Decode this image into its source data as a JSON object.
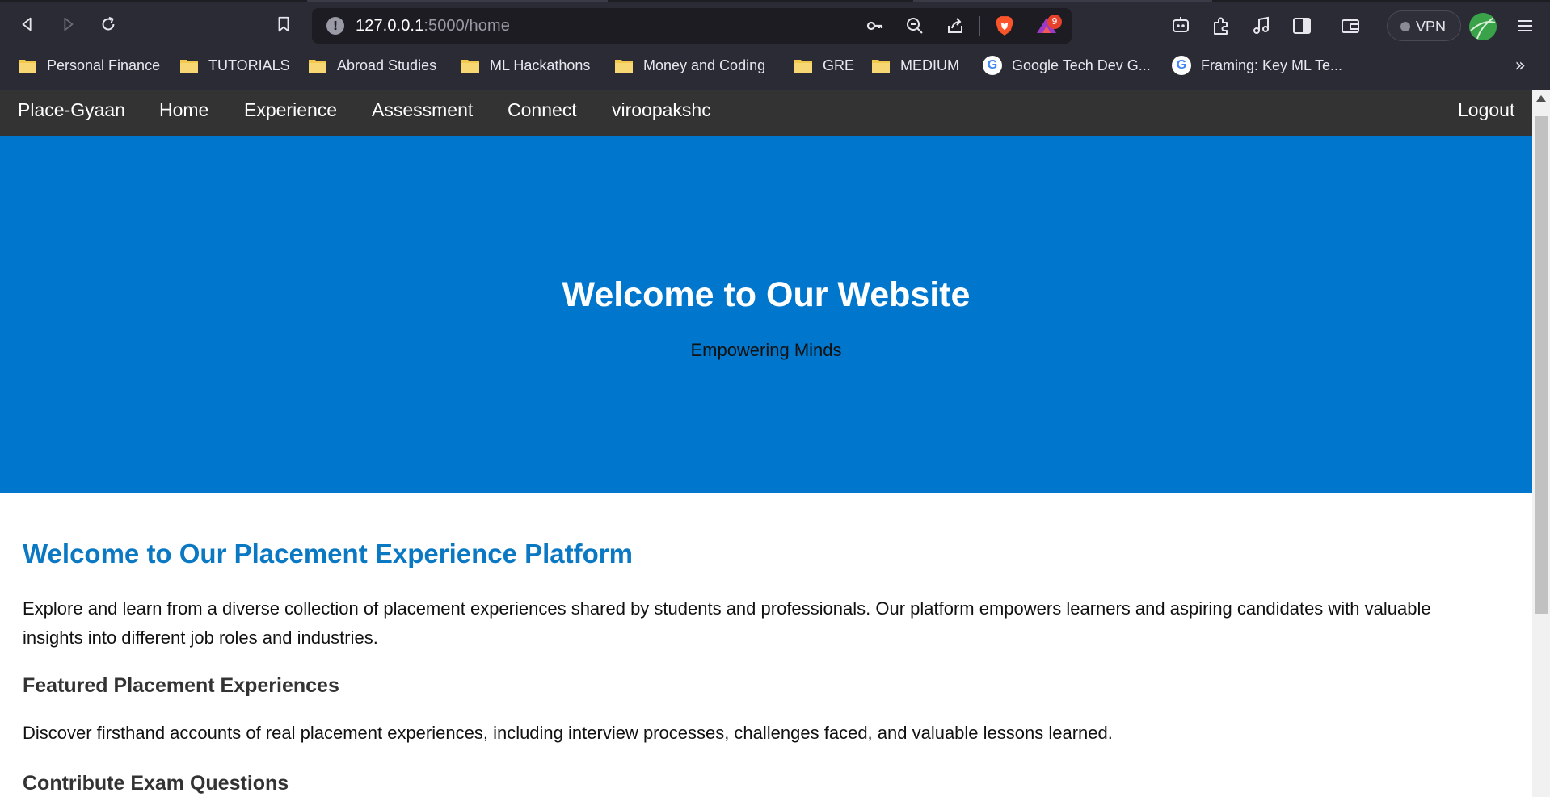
{
  "browser": {
    "url_host": "127.0.0.1",
    "url_path": ":5000/home",
    "rewards_badge": "9",
    "vpn_label": "VPN",
    "icons": {
      "back": "back-arrow-icon",
      "forward": "forward-arrow-icon",
      "reload": "reload-icon",
      "bookmark": "bookmark-icon",
      "info": "site-info-icon",
      "key": "key-icon",
      "zoom": "zoom-out-icon",
      "share": "share-icon",
      "brave": "brave-shields-icon",
      "rewards": "brave-rewards-icon",
      "leo": "leo-icon",
      "extensions": "extensions-icon",
      "media": "music-note-icon",
      "sidebar": "sidebar-icon",
      "wallet": "wallet-icon",
      "menu": "hamburger-menu-icon"
    },
    "bookmarks": [
      {
        "label": "Personal Finance",
        "icon": "folder-icon"
      },
      {
        "label": "TUTORIALS",
        "icon": "folder-icon"
      },
      {
        "label": "Abroad Studies",
        "icon": "folder-icon"
      },
      {
        "label": "ML Hackathons",
        "icon": "folder-icon"
      },
      {
        "label": "Money and Coding",
        "icon": "folder-icon"
      },
      {
        "label": "GRE",
        "icon": "folder-icon"
      },
      {
        "label": "MEDIUM",
        "icon": "folder-icon"
      },
      {
        "label": "Google Tech Dev G...",
        "icon": "google-icon"
      },
      {
        "label": "Framing: Key ML Te...",
        "icon": "google-icon"
      }
    ],
    "bookmarks_more": "»"
  },
  "nav": {
    "brand": "Place-Gyaan",
    "items": [
      "Home",
      "Experience",
      "Assessment",
      "Connect",
      "viroopakshc"
    ],
    "logout": "Logout"
  },
  "hero": {
    "title": "Welcome to Our Website",
    "subtitle": "Empowering Minds"
  },
  "content": {
    "heading": "Welcome to Our Placement Experience Platform",
    "intro": "Explore and learn from a diverse collection of placement experiences shared by students and professionals. Our platform empowers learners and aspiring candidates with valuable insights into different job roles and industries.",
    "featured_heading": "Featured Placement Experiences",
    "featured_text": "Discover firsthand accounts of real placement experiences, including interview processes, challenges faced, and valuable lessons learned.",
    "contribute_heading": "Contribute Exam Questions"
  },
  "colors": {
    "chrome_bg": "#2b2b35",
    "nav_bg": "#333333",
    "hero_bg": "#0077cc",
    "heading_blue": "#0a78c2"
  }
}
